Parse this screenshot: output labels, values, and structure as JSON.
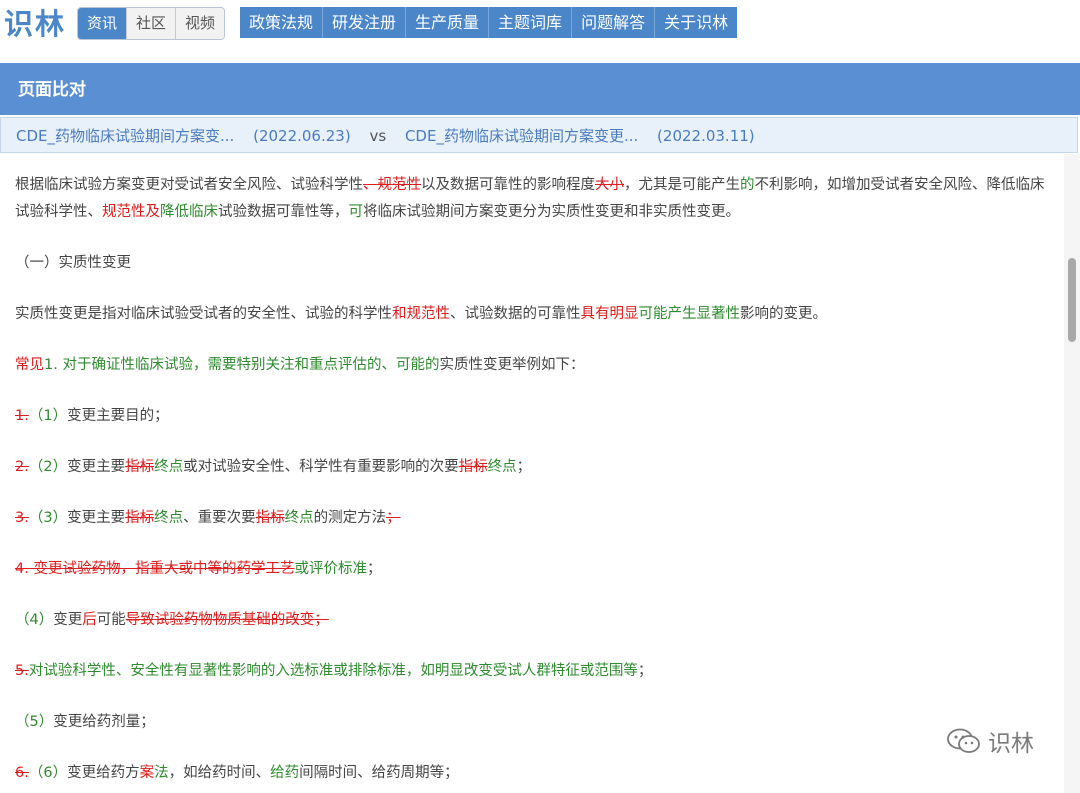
{
  "logo": "识林",
  "tabs": [
    "资讯",
    "社区",
    "视频"
  ],
  "nav": [
    "政策法规",
    "研发注册",
    "生产质量",
    "主题词库",
    "问题解答",
    "关于识林"
  ],
  "panel_title": "页面比对",
  "compare": {
    "left_doc": "CDE_药物临床试验期间方案变...",
    "left_date": "(2022.06.23)",
    "vs": "vs",
    "right_doc": "CDE_药物临床试验期间方案变更...",
    "right_date": "(2022.03.11)"
  },
  "paragraphs": [
    [
      [
        "t",
        "根据临床试验方案变更对受试者安全风险、试验科学性"
      ],
      [
        "d",
        "、规范性"
      ],
      [
        "t",
        "以及数据可靠性的影响程度"
      ],
      [
        "d",
        "大小"
      ],
      [
        "t",
        "，尤其是可能产生"
      ],
      [
        "i",
        "的"
      ],
      [
        "t",
        "不利影响，如增加受试者安全风险、降低临床试验科学性、"
      ],
      [
        "r",
        "规范性及"
      ],
      [
        "i",
        "降低临床"
      ],
      [
        "t",
        "试验数据可靠性等，"
      ],
      [
        "i",
        "可"
      ],
      [
        "t",
        "将临床试验期间方案变更分为实质性变更和非实质性变更。"
      ]
    ],
    [
      [
        "t",
        "（一）实质性变更"
      ]
    ],
    [
      [
        "t",
        "实质性变更是指对临床试验受试者的安全性、试验的科学性"
      ],
      [
        "r",
        "和规范性"
      ],
      [
        "t",
        "、试验数据的可靠性"
      ],
      [
        "r",
        "具有明显"
      ],
      [
        "i",
        "可能产生显著性"
      ],
      [
        "t",
        "影响的变更。"
      ]
    ],
    [
      [
        "r",
        "常见"
      ],
      [
        "i",
        "1. 对于确证性临床试验，需要特别关注和重点评估的、可能的"
      ],
      [
        "t",
        "实质性变更举例如下："
      ]
    ],
    [
      [
        "d",
        "1."
      ],
      [
        "i",
        "（1）"
      ],
      [
        "t",
        "变更主要目的；"
      ]
    ],
    [
      [
        "d",
        "2."
      ],
      [
        "i",
        "（2）"
      ],
      [
        "t",
        "变更主要"
      ],
      [
        "d",
        "指标"
      ],
      [
        "i",
        "终点"
      ],
      [
        "t",
        "或对试验安全性、科学性有重要影响的次要"
      ],
      [
        "d",
        "指标"
      ],
      [
        "i",
        "终点"
      ],
      [
        "t",
        "；"
      ]
    ],
    [
      [
        "d",
        "3."
      ],
      [
        "i",
        "（3）"
      ],
      [
        "t",
        "变更主要"
      ],
      [
        "d",
        "指标"
      ],
      [
        "i",
        "终点"
      ],
      [
        "t",
        "、重要次要"
      ],
      [
        "d",
        "指标"
      ],
      [
        "i",
        "终点"
      ],
      [
        "t",
        "的测定方法"
      ],
      [
        "d",
        "；"
      ]
    ],
    [
      [
        "d",
        "4. 变更试验药物，指重大或中等的药学工艺"
      ],
      [
        "i",
        "或评价标准"
      ],
      [
        "t",
        "；"
      ]
    ],
    [
      [
        "i",
        "（4）"
      ],
      [
        "t",
        "变更"
      ],
      [
        "r",
        "后"
      ],
      [
        "t",
        "可能"
      ],
      [
        "d",
        "导致试验药物物质基础的改变；"
      ]
    ],
    [
      [
        "d",
        "5."
      ],
      [
        "i",
        "对试验科学性、安全性有显著性影响的入选标准或排除标准，如明显改变受试人群特征或范围等"
      ],
      [
        "t",
        "；"
      ]
    ],
    [
      [
        "i",
        "（5）"
      ],
      [
        "t",
        "变更给药剂量；"
      ]
    ],
    [
      [
        "d",
        "6."
      ],
      [
        "i",
        "（6）"
      ],
      [
        "t",
        "变更给药方"
      ],
      [
        "r",
        "案"
      ],
      [
        "i",
        "法"
      ],
      [
        "t",
        "，如给药时间、"
      ],
      [
        "i",
        "给药"
      ],
      [
        "t",
        "间隔时间、给药周期等；"
      ]
    ]
  ],
  "watermark": "识林"
}
